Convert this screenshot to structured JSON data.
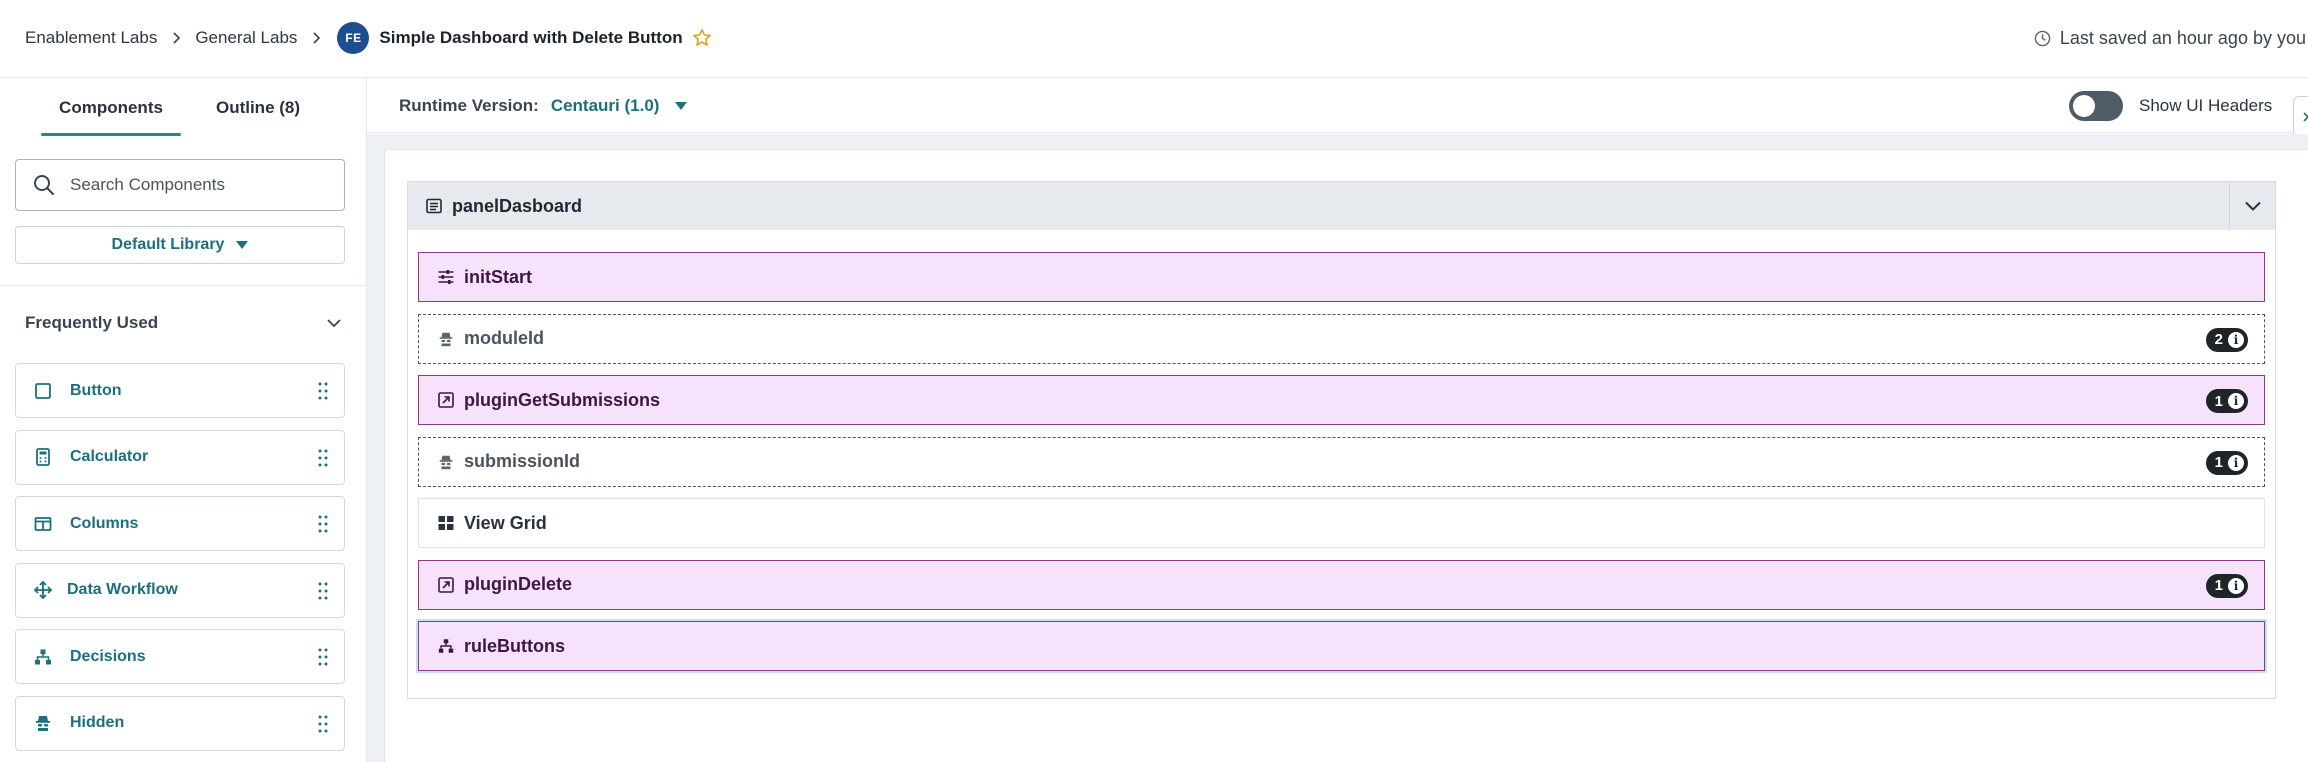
{
  "breadcrumb": {
    "items": [
      "Enablement Labs",
      "General Labs"
    ],
    "avatar": "FE",
    "app_title": "Simple Dashboard with Delete Button"
  },
  "header": {
    "saved_text": "Last saved an hour ago by you"
  },
  "sidebar": {
    "tabs": [
      {
        "label": "Components",
        "active": true
      },
      {
        "label": "Outline (8)",
        "active": false
      }
    ],
    "search": {
      "placeholder": "Search Components",
      "value": ""
    },
    "library_label": "Default Library",
    "section_title": "Frequently Used",
    "components": [
      {
        "label": "Button",
        "icon": "button-icon"
      },
      {
        "label": "Calculator",
        "icon": "calculator-icon"
      },
      {
        "label": "Columns",
        "icon": "columns-icon"
      },
      {
        "label": "Data Workflow",
        "icon": "data-workflow-icon"
      },
      {
        "label": "Decisions",
        "icon": "decisions-icon"
      },
      {
        "label": "Hidden",
        "icon": "hidden-icon"
      }
    ]
  },
  "topbar": {
    "runtime_label": "Runtime Version:",
    "runtime_value": "Centauri (1.0)",
    "toggle_label": "Show UI Headers",
    "toggle_on": false
  },
  "panel": {
    "title": "panelDasboard",
    "rows": [
      {
        "label": "initStart",
        "type": "plugin",
        "icon": "sliders-icon",
        "badge": null
      },
      {
        "label": "moduleId",
        "type": "hidden",
        "icon": "hidden-icon",
        "badge": "2"
      },
      {
        "label": "pluginGetSubmissions",
        "type": "plugin",
        "icon": "external-link-icon",
        "badge": "1"
      },
      {
        "label": "submissionId",
        "type": "hidden",
        "icon": "hidden-icon",
        "badge": "1"
      },
      {
        "label": "View Grid",
        "type": "plain",
        "icon": "grid-icon",
        "badge": null
      },
      {
        "label": "pluginDelete",
        "type": "plugin",
        "icon": "external-link-icon",
        "badge": "1"
      },
      {
        "label": "ruleButtons",
        "type": "plugin",
        "icon": "decisions-icon",
        "badge": null,
        "selected": true
      }
    ]
  },
  "colors": {
    "accent": "#1d6f7e",
    "plugin_bg": "#f6e3fb",
    "plugin_border": "#8b3a87",
    "avatar": "#1e4e8f",
    "star": "#d9a21b"
  }
}
